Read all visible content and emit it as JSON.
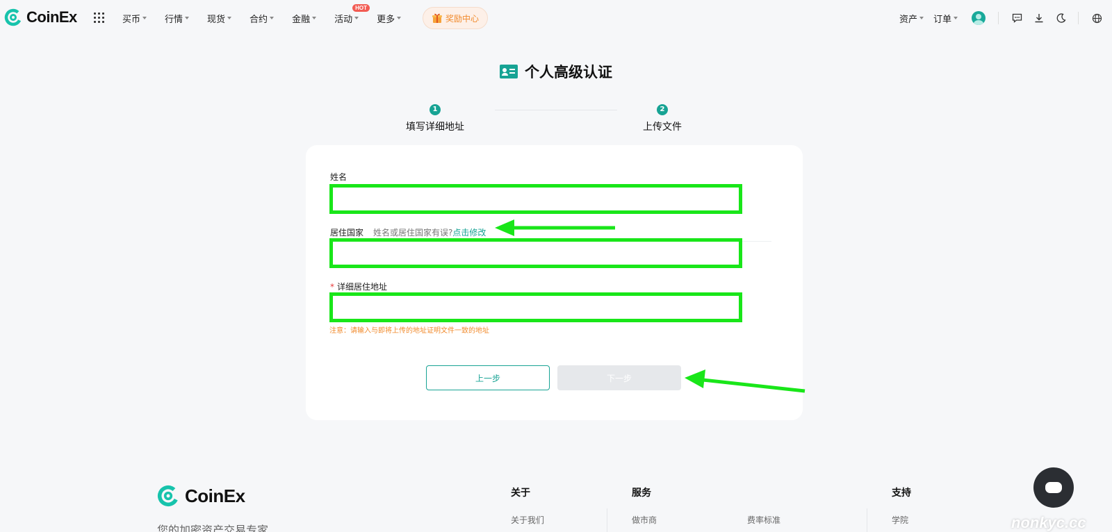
{
  "nav": {
    "brand": "CoinEx",
    "menu": [
      {
        "label": "买币"
      },
      {
        "label": "行情"
      },
      {
        "label": "现货"
      },
      {
        "label": "合约"
      },
      {
        "label": "金融"
      },
      {
        "label": "活动",
        "badge": "HOT"
      },
      {
        "label": "更多"
      }
    ],
    "reward": "奖励中心",
    "right": {
      "assets": "资产",
      "orders": "订单"
    }
  },
  "page": {
    "title": "个人高级认证",
    "steps": [
      {
        "num": "1",
        "label": "填写详细地址"
      },
      {
        "num": "2",
        "label": "上传文件"
      }
    ]
  },
  "form": {
    "name_label": "姓名",
    "name_value": "",
    "country_label": "居住国家",
    "country_hint": "姓名或居住国家有误?",
    "country_link": "点击修改",
    "country_value": "",
    "address_required": "*",
    "address_label": "详细居住地址",
    "address_value": "",
    "address_note": "注意：请输入与即将上传的地址证明文件一致的地址",
    "prev_button": "上一步",
    "next_button": "下一步"
  },
  "footer": {
    "brand": "CoinEx",
    "slogan": "您的加密资产交易专家",
    "columns": {
      "about": {
        "title": "关于",
        "link": "关于我们"
      },
      "service": {
        "title": "服务",
        "link1": "做市商",
        "link2": "费率标准"
      },
      "support": {
        "title": "支持",
        "link": "学院"
      }
    }
  },
  "watermark": "nonkyc.cc",
  "colors": {
    "accent": "#17a394",
    "highlight": "#19e619",
    "warning": "#f18a2c"
  }
}
